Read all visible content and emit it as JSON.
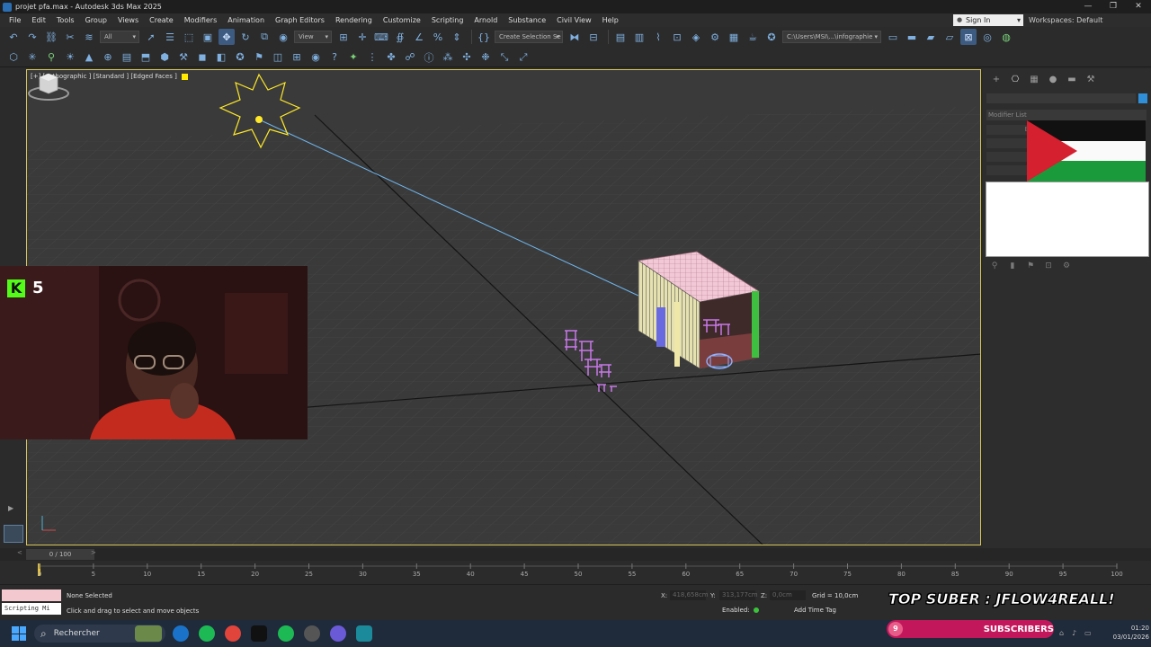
{
  "window": {
    "title": "projet pfa.max - Autodesk 3ds Max 2025",
    "controls": [
      "—",
      "❐",
      "✕"
    ]
  },
  "menubar": {
    "items": [
      "File",
      "Edit",
      "Tools",
      "Group",
      "Views",
      "Create",
      "Modifiers",
      "Animation",
      "Graph Editors",
      "Rendering",
      "Customize",
      "Scripting",
      "Arnold",
      "Substance",
      "Civil View",
      "Help"
    ],
    "sign_in": "Sign In",
    "workspaces_label": "Workspaces:",
    "workspaces_value": "Default"
  },
  "toolbar": {
    "selection_filter": "All",
    "ref_coord": "View",
    "named_selection": "Create Selection Se",
    "project_path": "C:\\Users\\MSI\\...\\infographie"
  },
  "viewport": {
    "label": "[+] [Orthographic ] [Standard ] [Edged Faces ]",
    "border_color": "#d9c65a"
  },
  "webcam_overlay": {
    "platform_icon": "K",
    "viewer_count": "5",
    "platform_color": "#53fc18"
  },
  "command_panel": {
    "modifier_list": "Modifier List",
    "rows": [
      "Edit",
      "Lat",
      "Be",
      "Sh"
    ],
    "flag": "palestine-flag"
  },
  "timeline": {
    "frame_indicator": "0 / 100",
    "ticks": [
      "0",
      "5",
      "10",
      "15",
      "20",
      "25",
      "30",
      "35",
      "40",
      "45",
      "50",
      "55",
      "60",
      "65",
      "70",
      "75",
      "80",
      "85",
      "90",
      "95",
      "100"
    ]
  },
  "status": {
    "scripting_listener": "Scripting Mi",
    "selection": "None Selected",
    "prompt": "Click and drag to select and move objects",
    "x_label": "X:",
    "x_value": "418,658cm",
    "y_label": "Y:",
    "y_value": "313,177cm",
    "z_label": "Z:",
    "z_value": "0,0cm",
    "grid": "Grid = 10,0cm",
    "enabled": "Enabled:",
    "add_time_tag": "Add Time Tag",
    "overlay_banner": "TOP SUBER : JFLOW4REALL!"
  },
  "subscribers_overlay": {
    "count": "9",
    "label": "SUBSCRIBERS"
  },
  "taskbar": {
    "search": "Rechercher",
    "time": "01:20",
    "date": "03/01/2026"
  }
}
